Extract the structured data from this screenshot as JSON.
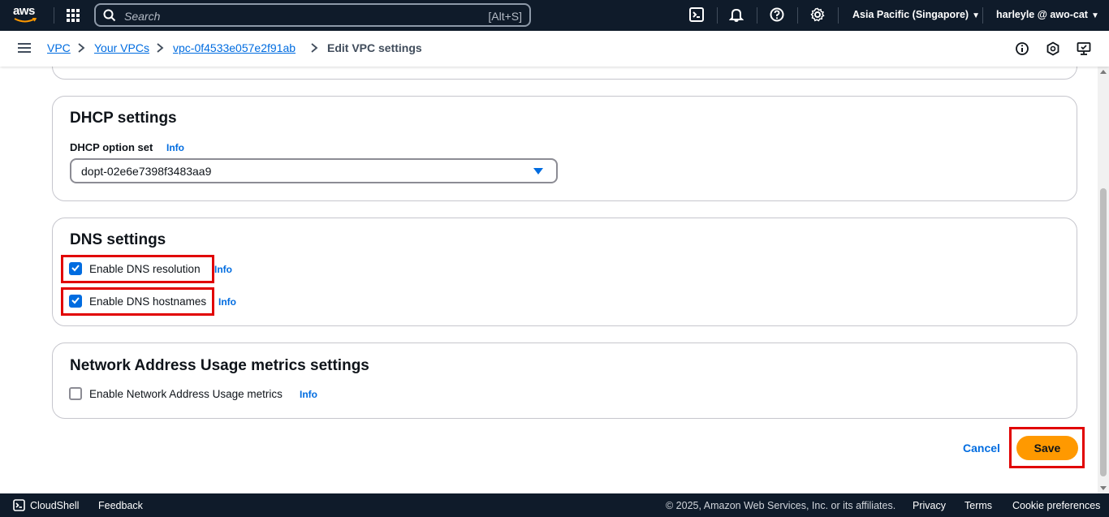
{
  "topnav": {
    "logo_text": "aws",
    "search_placeholder": "Search",
    "search_shortcut": "[Alt+S]",
    "region": "Asia Pacific (Singapore)",
    "user": "harleyle @ awo-cat",
    "icons": [
      "apps-grid-icon",
      "search-icon",
      "cloudshell-icon",
      "bell-icon",
      "help-icon",
      "gear-icon"
    ]
  },
  "breadcrumb": {
    "items": [
      "VPC",
      "Your VPCs",
      "vpc-0f4533e057e2f91ab"
    ],
    "current": "Edit VPC settings"
  },
  "dhcp": {
    "title": "DHCP settings",
    "option_label": "DHCP option set",
    "info": "Info",
    "selected": "dopt-02e6e7398f3483aa9"
  },
  "dns": {
    "title": "DNS settings",
    "resolution_label": "Enable DNS resolution",
    "resolution_checked": true,
    "resolution_info": "Info",
    "hostnames_label": "Enable DNS hostnames",
    "hostnames_checked": true,
    "hostnames_info": "Info"
  },
  "nau": {
    "title": "Network Address Usage metrics settings",
    "metrics_label": "Enable Network Address Usage metrics",
    "metrics_checked": false,
    "info": "Info"
  },
  "actions": {
    "cancel": "Cancel",
    "save": "Save"
  },
  "footer": {
    "cloudshell": "CloudShell",
    "feedback": "Feedback",
    "copyright": "© 2025, Amazon Web Services, Inc. or its affiliates.",
    "privacy": "Privacy",
    "terms": "Terms",
    "cookies": "Cookie preferences"
  },
  "colors": {
    "nav_bg": "#0f1b2a",
    "link": "#006ce0",
    "primary": "#ff9900",
    "highlight": "#e10000"
  }
}
